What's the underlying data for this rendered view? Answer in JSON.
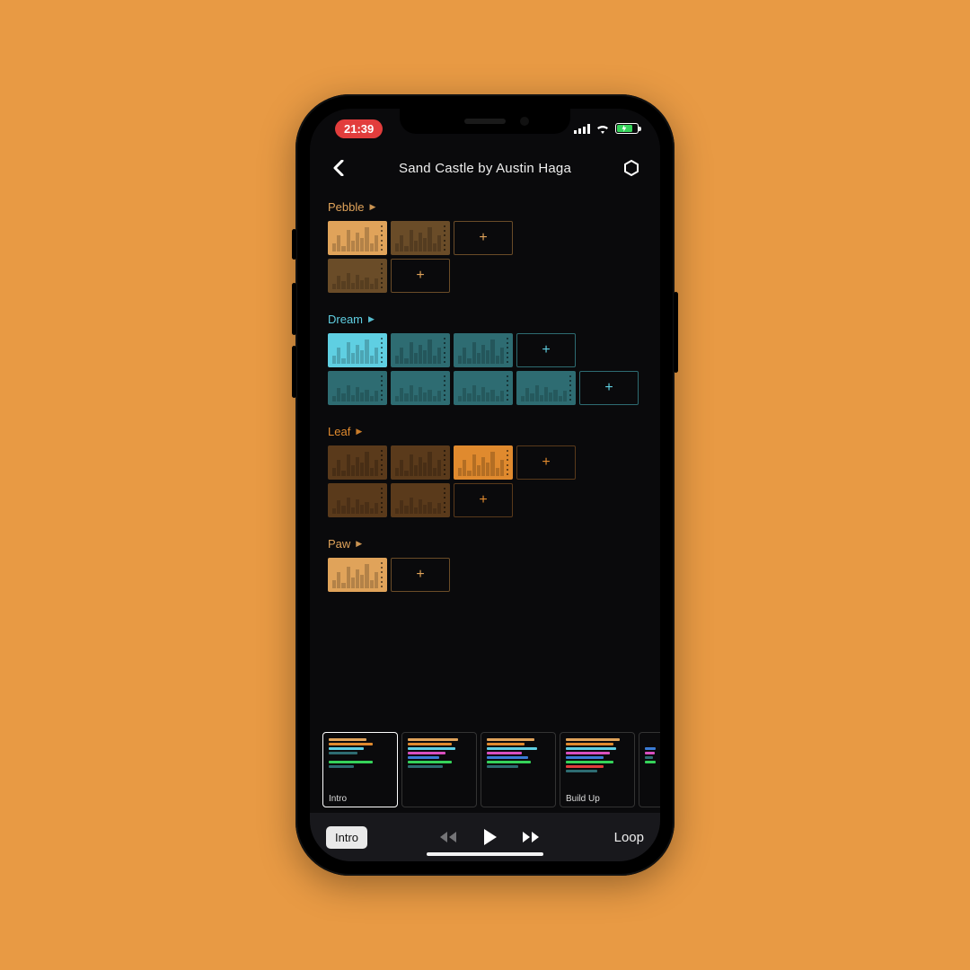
{
  "status": {
    "time": "21:39"
  },
  "nav": {
    "title": "Sand Castle by Austin Haga"
  },
  "colors": {
    "pebble": "#e0a35a",
    "pebble_dim": "#6a4c28",
    "dream": "#5fcfe2",
    "dream_dim": "#2e6c72",
    "leaf": "#e08a2e",
    "leaf_dim": "#5a3a1b",
    "paw": "#e0a35a",
    "paw_dim": "#6a4c28"
  },
  "tracks": [
    {
      "name": "Pebble",
      "key": "pebble",
      "rows": [
        {
          "clips": [
            {
              "t": "full"
            },
            {
              "t": "dim"
            },
            {
              "t": "add"
            }
          ]
        },
        {
          "clips": [
            {
              "t": "dimwave"
            },
            {
              "t": "add"
            }
          ]
        }
      ]
    },
    {
      "name": "Dream",
      "key": "dream",
      "rows": [
        {
          "clips": [
            {
              "t": "full"
            },
            {
              "t": "dimbars"
            },
            {
              "t": "dimbars"
            },
            {
              "t": "add"
            }
          ]
        },
        {
          "clips": [
            {
              "t": "dimwave"
            },
            {
              "t": "dimwave"
            },
            {
              "t": "dimwave"
            },
            {
              "t": "dimwave"
            },
            {
              "t": "add"
            }
          ]
        }
      ]
    },
    {
      "name": "Leaf",
      "key": "leaf",
      "rows": [
        {
          "clips": [
            {
              "t": "dimbars"
            },
            {
              "t": "dim"
            },
            {
              "t": "full"
            },
            {
              "t": "add"
            }
          ]
        },
        {
          "clips": [
            {
              "t": "dimwave"
            },
            {
              "t": "dimwave"
            },
            {
              "t": "add"
            }
          ]
        }
      ]
    },
    {
      "name": "Paw",
      "key": "paw",
      "rows": [
        {
          "clips": [
            {
              "t": "full"
            },
            {
              "t": "add"
            }
          ]
        }
      ]
    }
  ],
  "scenes": [
    {
      "label": "Intro",
      "selected": true,
      "lines": [
        [
          "#e0a35a",
          60
        ],
        [
          "#e08a2e",
          70
        ],
        [
          "#5fcfe2",
          55
        ],
        [
          "#2e6c72",
          45
        ],
        [
          "",
          0
        ],
        [
          "#35d35a",
          70
        ],
        [
          "#2e6c72",
          40
        ]
      ]
    },
    {
      "label": "",
      "lines": [
        [
          "#e0a35a",
          80
        ],
        [
          "#e08a2e",
          70
        ],
        [
          "#5fcfe2",
          75
        ],
        [
          "#d94fbf",
          60
        ],
        [
          "#3a7bd5",
          50
        ],
        [
          "#35d35a",
          70
        ],
        [
          "#2e6c72",
          55
        ]
      ]
    },
    {
      "label": "",
      "lines": [
        [
          "#e0a35a",
          75
        ],
        [
          "#e08a2e",
          60
        ],
        [
          "#5fcfe2",
          80
        ],
        [
          "#d94fbf",
          55
        ],
        [
          "#3a7bd5",
          65
        ],
        [
          "#35d35a",
          70
        ],
        [
          "#2e6c72",
          50
        ]
      ]
    },
    {
      "label": "Build Up",
      "lines": [
        [
          "#e0a35a",
          85
        ],
        [
          "#e08a2e",
          75
        ],
        [
          "#5fcfe2",
          80
        ],
        [
          "#d94fbf",
          70
        ],
        [
          "#3a7bd5",
          60
        ],
        [
          "#35d35a",
          75
        ],
        [
          "#e23d3c",
          60
        ],
        [
          "#2e6c72",
          50
        ]
      ]
    },
    {
      "label": "",
      "lines": [
        [
          "",
          0
        ],
        [
          "",
          0
        ],
        [
          "#3a7bd5",
          40
        ],
        [
          "#d94fbf",
          35
        ],
        [
          "#2e6c72",
          30
        ],
        [
          "#35d35a",
          40
        ]
      ]
    }
  ],
  "transport": {
    "current": "Intro",
    "loop": "Loop"
  }
}
